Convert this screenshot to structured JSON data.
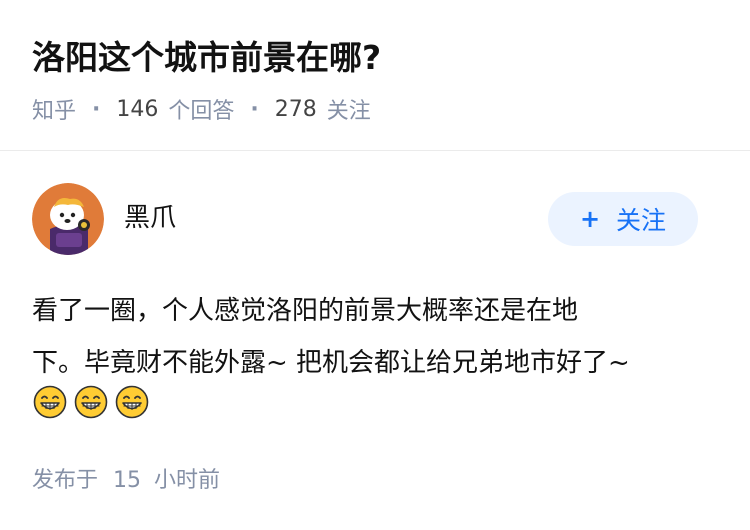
{
  "question": {
    "title": "洛阳这个城市前景在哪?",
    "source": "知乎",
    "answer_count": "146",
    "answer_label": "个回答",
    "follower_count": "278",
    "follower_label": "关注",
    "separator": "·"
  },
  "answer": {
    "author_name": "黑爪",
    "follow_plus": "+",
    "follow_label": "关注",
    "content_line1": "看了一圈，个人感觉洛阳的前景大概率还是在地",
    "content_line2": "下。毕竟财不能外露~ 把机会都让给兄弟地市好了~",
    "emojis": [
      "grin-emoji",
      "grin-emoji",
      "grin-emoji"
    ],
    "published_prefix": "发布于",
    "published_value": "15",
    "published_unit": "小时前"
  },
  "colors": {
    "accent": "#1772f6",
    "follow_bg": "#ebf3ff",
    "meta_gray": "#8590a6",
    "avatar_bg": "#e07b39"
  }
}
